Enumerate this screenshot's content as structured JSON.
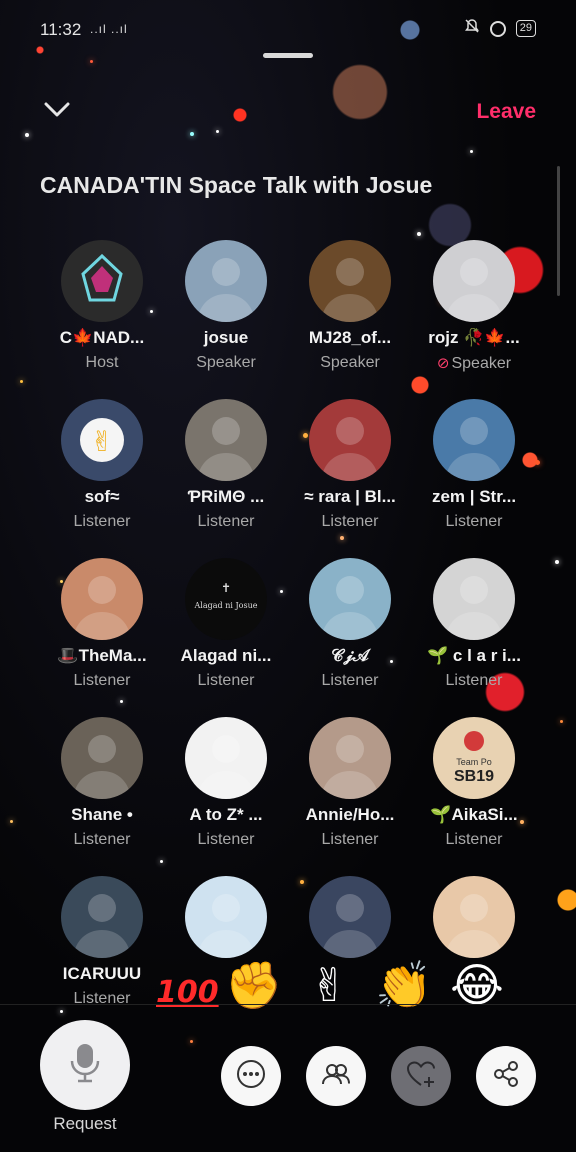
{
  "status_bar": {
    "time": "11:32",
    "signal": "..ıl ..ıl",
    "battery": "29"
  },
  "header": {
    "leave_label": "Leave",
    "title": "CANADA'TIN Space Talk with Josue"
  },
  "members": [
    {
      "name": "C🍁NAD...",
      "role": "Host",
      "avatar_color": "#2b2b2b",
      "muted": false
    },
    {
      "name": "josue",
      "role": "Speaker",
      "avatar_color": "#8aa2b8",
      "muted": false
    },
    {
      "name": "MJ28_of...",
      "role": "Speaker",
      "avatar_color": "#6b4a2a",
      "muted": false
    },
    {
      "name": "rojz 🥀🍁...",
      "role": "Speaker",
      "avatar_color": "#cfcfd2",
      "muted": true
    },
    {
      "name": "sof≈",
      "role": "Listener",
      "avatar_color": "#3a4a6a",
      "muted": false
    },
    {
      "name": "ƤRiMΘ ...",
      "role": "Listener",
      "avatar_color": "#7a746c",
      "muted": false
    },
    {
      "name": "≈ rara | Bl...",
      "role": "Listener",
      "avatar_color": "#a33a3a",
      "muted": false
    },
    {
      "name": "zem | Str...",
      "role": "Listener",
      "avatar_color": "#4a7aa8",
      "muted": false
    },
    {
      "name": "🎩TheMa...",
      "role": "Listener",
      "avatar_color": "#c98a6a",
      "muted": false
    },
    {
      "name": "Alagad ni...",
      "role": "Listener",
      "avatar_color": "#0b0b0b",
      "muted": false
    },
    {
      "name": "𝒞𝒿𝒜",
      "role": "Listener",
      "avatar_color": "#8ab2c8",
      "muted": false
    },
    {
      "name": "🌱 c l a r i...",
      "role": "Listener",
      "avatar_color": "#d4d4d4",
      "muted": false
    },
    {
      "name": "Shane •",
      "role": "Listener",
      "avatar_color": "#6a6258",
      "muted": false
    },
    {
      "name": "A to Z* ...",
      "role": "Listener",
      "avatar_color": "#f2f2f2",
      "muted": false
    },
    {
      "name": "Annie/Ho...",
      "role": "Listener",
      "avatar_color": "#b49a8a",
      "muted": false
    },
    {
      "name": "🌱AikaSi...",
      "role": "Listener",
      "avatar_color": "#e8d2b2",
      "muted": false
    },
    {
      "name": "ICARUUU",
      "role": "Listener",
      "avatar_color": "#3a4a5a",
      "muted": false
    },
    {
      "name": "",
      "role": "",
      "avatar_color": "#cfe2f0",
      "muted": false
    },
    {
      "name": "",
      "role": "",
      "avatar_color": "#3a4660",
      "muted": false
    },
    {
      "name": "",
      "role": "",
      "avatar_color": "#e8c8a8",
      "muted": false
    }
  ],
  "host_avatar_text": "",
  "listener_sof_emoji": "✌",
  "alagad_logo_text": "Alagad ni Josue",
  "sb19_badge": {
    "line1": "Team Po",
    "line2": "SB19"
  },
  "reactions": {
    "hundred": "100",
    "fist": "✊",
    "victory": "✌",
    "clap": "👏",
    "laugh": "😂"
  },
  "bottom_bar": {
    "request_label": "Request"
  },
  "colors": {
    "accent": "#ff2e6a",
    "background": "#050507"
  }
}
